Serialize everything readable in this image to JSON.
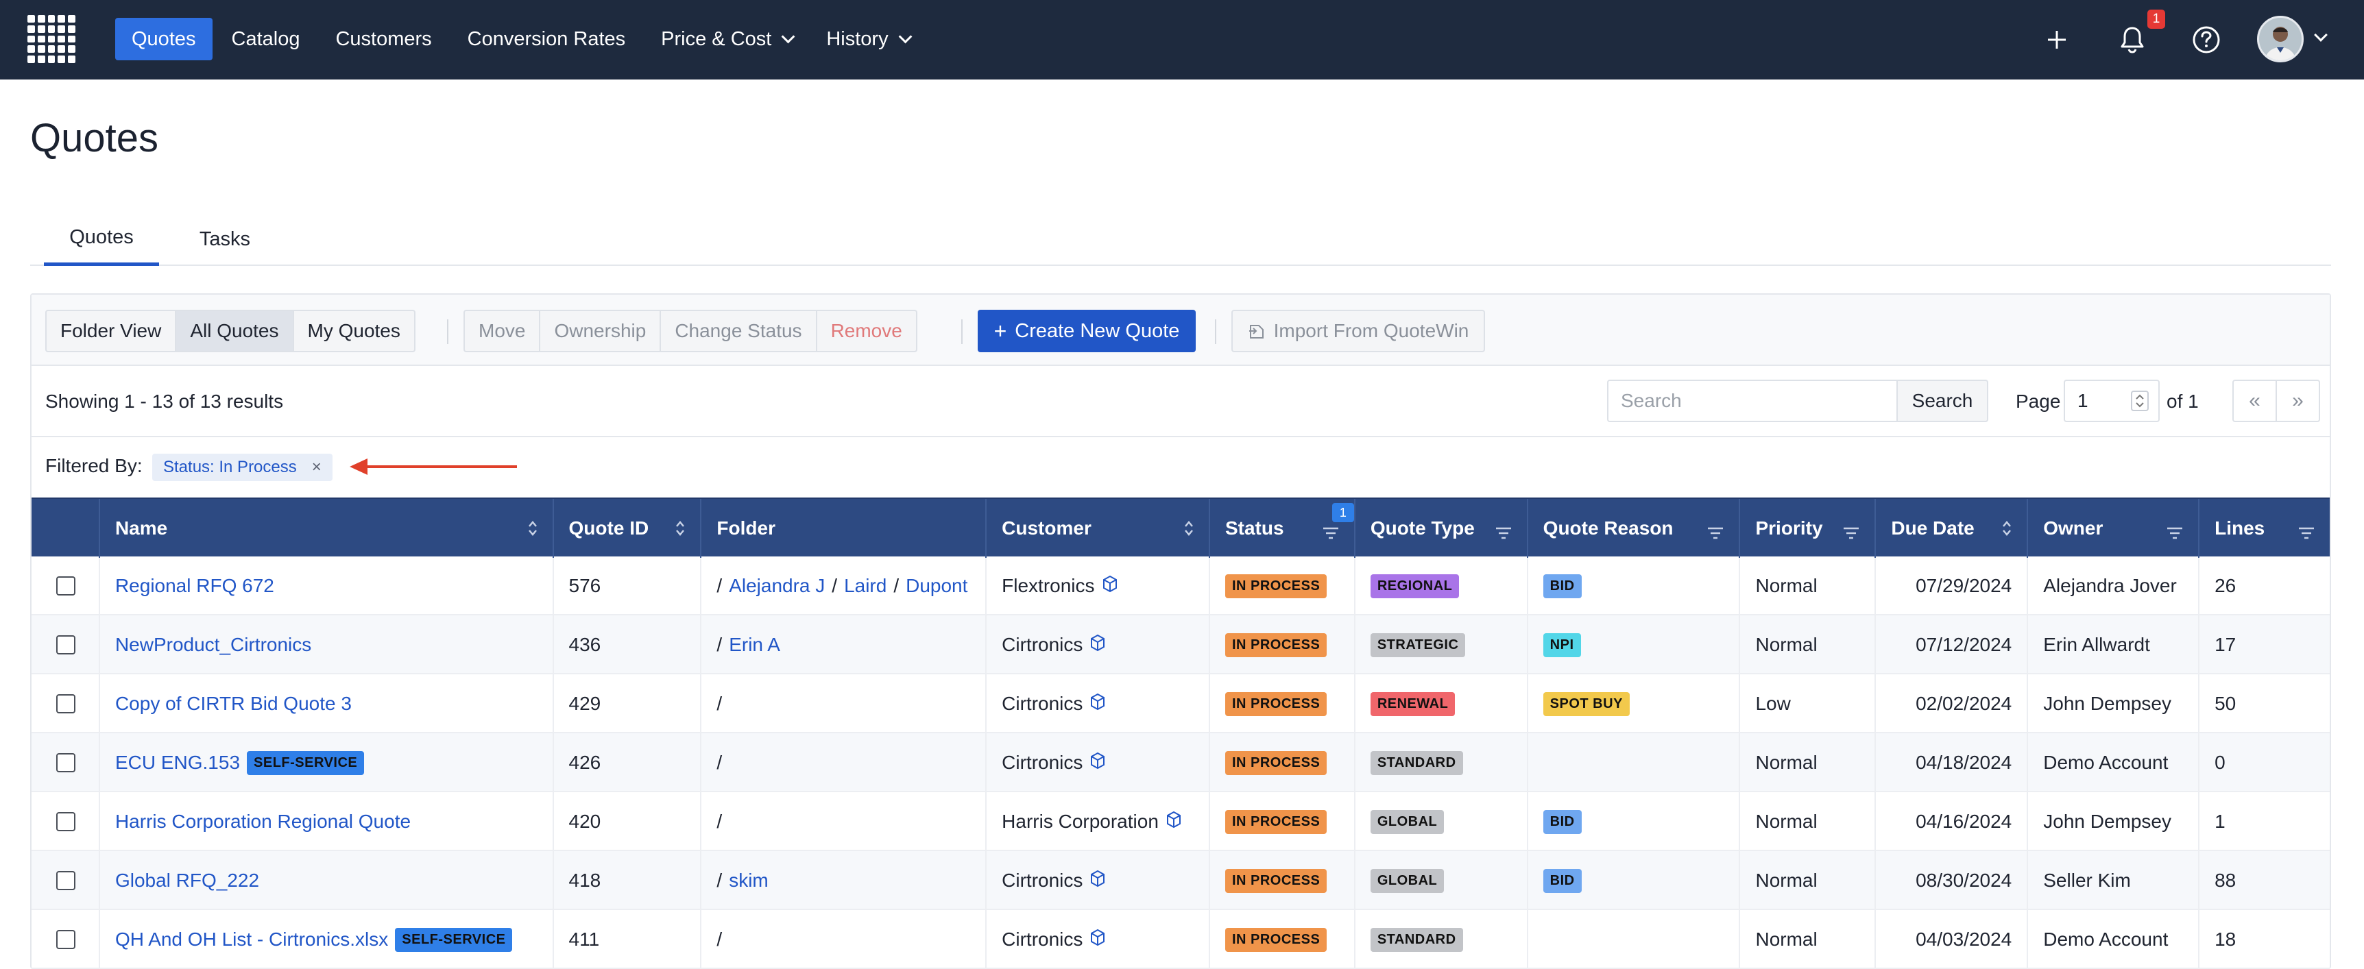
{
  "nav": {
    "items": [
      {
        "label": "Quotes",
        "active": true,
        "dropdown": false
      },
      {
        "label": "Catalog",
        "active": false,
        "dropdown": false
      },
      {
        "label": "Customers",
        "active": false,
        "dropdown": false
      },
      {
        "label": "Conversion Rates",
        "active": false,
        "dropdown": false
      },
      {
        "label": "Price & Cost",
        "active": false,
        "dropdown": true
      },
      {
        "label": "History",
        "active": false,
        "dropdown": true
      }
    ],
    "notification_count": "1",
    "icons": [
      "grid-logo-icon",
      "plus-icon",
      "bell-icon",
      "help-icon",
      "avatar",
      "chevron-down-icon"
    ]
  },
  "page": {
    "title": "Quotes"
  },
  "tabs": [
    {
      "label": "Quotes",
      "active": true
    },
    {
      "label": "Tasks",
      "active": false
    }
  ],
  "toolbar": {
    "views": [
      "Folder View",
      "All Quotes",
      "My Quotes"
    ],
    "active_view": "All Quotes",
    "actions": [
      "Move",
      "Ownership",
      "Change Status",
      "Remove"
    ],
    "create_label": "Create New Quote",
    "import_label": "Import From QuoteWin"
  },
  "results": {
    "showing": "Showing 1 - 13 of 13 results",
    "search_placeholder": "Search",
    "search_button": "Search",
    "page_label": "Page",
    "page_value": "1",
    "of_label": "of 1",
    "prev": "«",
    "next": "»"
  },
  "filter": {
    "label": "Filtered By:",
    "chip": "Status: In Process",
    "chip_close": "×"
  },
  "colors": {
    "nav_bg": "#1e2a3e",
    "accent": "#2156c7",
    "table_header": "#2d4a82",
    "in_process": "#f0944a",
    "regional": "#a974e8",
    "strategic": "#c2c4c8",
    "renewal": "#f0666b",
    "standard": "#c2c4c8",
    "global": "#c2c4c8",
    "bid": "#6fa7f0",
    "npi": "#52d6e8",
    "spot_buy": "#f2c94c",
    "self_service": "#2f7fe8"
  },
  "table": {
    "columns": [
      "",
      "Name",
      "Quote ID",
      "Folder",
      "Customer",
      "Status",
      "Quote Type",
      "Quote Reason",
      "Priority",
      "Due Date",
      "Owner",
      "Lines"
    ],
    "status_filter_count": "1",
    "rows": [
      {
        "name": "Regional RFQ 672",
        "self_service": "",
        "quote_id": "576",
        "folder": [
          "Alejandra J",
          "Laird",
          "Dupont"
        ],
        "customer": "Flextronics",
        "status": "IN PROCESS",
        "type": "REGIONAL",
        "type_color": "#a974e8",
        "reason": "BID",
        "reason_color": "#6fa7f0",
        "priority": "Normal",
        "due": "07/29/2024",
        "owner": "Alejandra Jover",
        "lines": "26"
      },
      {
        "name": "NewProduct_Cirtronics",
        "self_service": "",
        "quote_id": "436",
        "folder": [
          "Erin A"
        ],
        "customer": "Cirtronics",
        "status": "IN PROCESS",
        "type": "STRATEGIC",
        "type_color": "#c2c4c8",
        "reason": "NPI",
        "reason_color": "#52d6e8",
        "priority": "Normal",
        "due": "07/12/2024",
        "owner": "Erin Allwardt",
        "lines": "17"
      },
      {
        "name": "Copy of CIRTR Bid Quote 3",
        "self_service": "",
        "quote_id": "429",
        "folder": [],
        "customer": "Cirtronics",
        "status": "IN PROCESS",
        "type": "RENEWAL",
        "type_color": "#f0666b",
        "reason": "SPOT BUY",
        "reason_color": "#f2c94c",
        "priority": "Low",
        "due": "02/02/2024",
        "owner": "John Dempsey",
        "lines": "50"
      },
      {
        "name": "ECU ENG.153",
        "self_service": "SELF-SERVICE",
        "quote_id": "426",
        "folder": [],
        "customer": "Cirtronics",
        "status": "IN PROCESS",
        "type": "STANDARD",
        "type_color": "#c2c4c8",
        "reason": "",
        "reason_color": "",
        "priority": "Normal",
        "due": "04/18/2024",
        "owner": "Demo Account",
        "lines": "0"
      },
      {
        "name": "Harris Corporation Regional Quote",
        "self_service": "",
        "quote_id": "420",
        "folder": [],
        "customer": "Harris Corporation",
        "status": "IN PROCESS",
        "type": "GLOBAL",
        "type_color": "#c2c4c8",
        "reason": "BID",
        "reason_color": "#6fa7f0",
        "priority": "Normal",
        "due": "04/16/2024",
        "owner": "John Dempsey",
        "lines": "1"
      },
      {
        "name": "Global RFQ_222",
        "self_service": "",
        "quote_id": "418",
        "folder": [
          "skim"
        ],
        "customer": "Cirtronics",
        "status": "IN PROCESS",
        "type": "GLOBAL",
        "type_color": "#c2c4c8",
        "reason": "BID",
        "reason_color": "#6fa7f0",
        "priority": "Normal",
        "due": "08/30/2024",
        "owner": "Seller Kim",
        "lines": "88"
      },
      {
        "name": "QH And OH List - Cirtronics.xlsx",
        "self_service": "SELF-SERVICE",
        "quote_id": "411",
        "folder": [],
        "customer": "Cirtronics",
        "status": "IN PROCESS",
        "type": "STANDARD",
        "type_color": "#c2c4c8",
        "reason": "",
        "reason_color": "",
        "priority": "Normal",
        "due": "04/03/2024",
        "owner": "Demo Account",
        "lines": "18"
      }
    ]
  }
}
